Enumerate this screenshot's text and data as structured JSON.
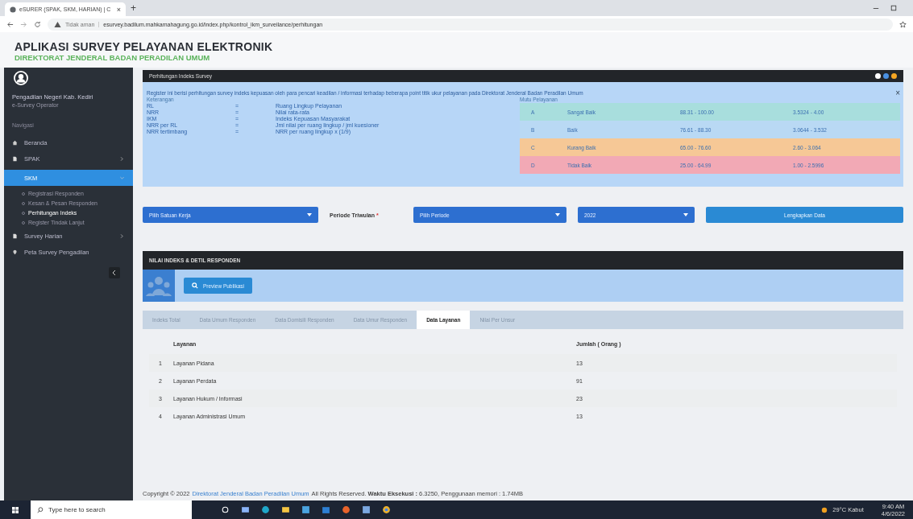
{
  "browser": {
    "tab_title": "eSURER (SPAK, SKM, HARIAN) | C",
    "close": "×",
    "new_tab": "+",
    "security": "Tidak aman",
    "url": "esurvey.badilum.mahkamahagung.go.id/index.php/kontrol_ikm_surveilance/perhitungan"
  },
  "app": {
    "title": "APLIKASI SURVEY PELAYANAN ELEKTRONIK",
    "subtitle": "DIREKTORAT JENDERAL BADAN PERADILAN UMUM"
  },
  "sidebar": {
    "user_name": "Pengadilan Negeri Kab. Kediri",
    "role": "e-Survey Operator",
    "section": "Navigasi",
    "items": [
      {
        "label": "Beranda",
        "kind": "home",
        "selected": false
      },
      {
        "label": "SPAK",
        "kind": "menu",
        "selected": false
      },
      {
        "label": "SKM",
        "kind": "group",
        "selected": true,
        "children": [
          {
            "label": "Registrasi Responden",
            "selected": false
          },
          {
            "label": "Kesan & Pesan Responden",
            "selected": false
          },
          {
            "label": "Perhitungan Indeks",
            "selected": true
          },
          {
            "label": "Register Tindak Lanjut",
            "selected": false
          }
        ]
      },
      {
        "label": "Survey Harian",
        "kind": "menu",
        "selected": false
      },
      {
        "label": "Peta Survey Pengadilan",
        "kind": "map",
        "selected": false
      }
    ]
  },
  "panel": {
    "title": "Perhitungan Indeks Survey",
    "description": "Register ini berisi perhitungan survey indeks kepuasan oleh para pencari keadilan / informasi terhadap beberapa point titik ukur pelayanan pada Direktorat Jenderal Badan Peradilan Umum",
    "legend_title": "Keterangan",
    "legend": [
      {
        "term": "RL",
        "sep": "=",
        "meaning": "Ruang Lingkup Pelayanan"
      },
      {
        "term": "NRR",
        "sep": "=",
        "meaning": "Nilai rata-rata"
      },
      {
        "term": "IKM",
        "sep": "=",
        "meaning": "Indeks Kepuasan Masyarakat"
      },
      {
        "term": "NRR per RL",
        "sep": "=",
        "meaning": "Jml nilai per ruang lingkup / jml kuesioner"
      },
      {
        "term": "NRR tertimbang",
        "sep": "=",
        "meaning": "NRR per ruang lingkup x (1/9)"
      }
    ],
    "close": "×",
    "mutu_title": "Mutu Pelayanan",
    "mutu": [
      {
        "grade": "A",
        "label": "Sangat Baik",
        "range": "88.31 - 100.00",
        "nrr": "3.5324 - 4.00",
        "color": "#a8dedd"
      },
      {
        "grade": "B",
        "label": "Baik",
        "range": "76.61 - 88.30",
        "nrr": "3.0644 - 3.532",
        "color": "#b9d9f4"
      },
      {
        "grade": "C",
        "label": "Kurang Baik",
        "range": "65.00 - 76.60",
        "nrr": "2.60 - 3.064",
        "color": "#f6c896"
      },
      {
        "grade": "D",
        "label": "Tidak Baik",
        "range": "25.00 - 64.99",
        "nrr": "1.00 - 2.5996",
        "color": "#f2a9b5"
      }
    ]
  },
  "filters": {
    "unit": "Pilih Satuan Kerja",
    "period_label": "Periode Triwulan",
    "required": "*",
    "period": "Pilih Periode",
    "year": "2022",
    "submit": "Lengkapkan Data"
  },
  "results": {
    "title": "NILAI INDEKS & DETIL RESPONDEN",
    "preview": "Preview Publikasi",
    "tabs": [
      {
        "label": "Indeks Total",
        "selected": false
      },
      {
        "label": "Data Umum Responden",
        "selected": false
      },
      {
        "label": "Data Domisili Responden",
        "selected": false
      },
      {
        "label": "Data Umur Responden",
        "selected": false
      },
      {
        "label": "Data Layanan",
        "selected": true
      },
      {
        "label": "Nilai Per Unsur",
        "selected": false
      }
    ],
    "table": {
      "columns": [
        "Layanan",
        "Jumlah ( Orang )"
      ],
      "rows": [
        {
          "no": "1",
          "layanan": "Layanan Pidana",
          "jumlah": "13"
        },
        {
          "no": "2",
          "layanan": "Layanan Perdata",
          "jumlah": "91"
        },
        {
          "no": "3",
          "layanan": "Layanan Hukum / Informasi",
          "jumlah": "23"
        },
        {
          "no": "4",
          "layanan": "Layanan Administrasi Umum",
          "jumlah": "13"
        }
      ]
    }
  },
  "footer": {
    "copyright": "Copyright © 2022",
    "link": "Direktorat Jenderal Badan Peradilan Umum",
    "rest": "All Rights Reserved. **Waktu Eksekusi :** 6.3250, Penggunaan memori : 1.74MB"
  },
  "taskbar": {
    "search": "Type here to search",
    "weather": "29°C Kabut",
    "time": "9:40 AM",
    "date": "4/6/2022"
  }
}
